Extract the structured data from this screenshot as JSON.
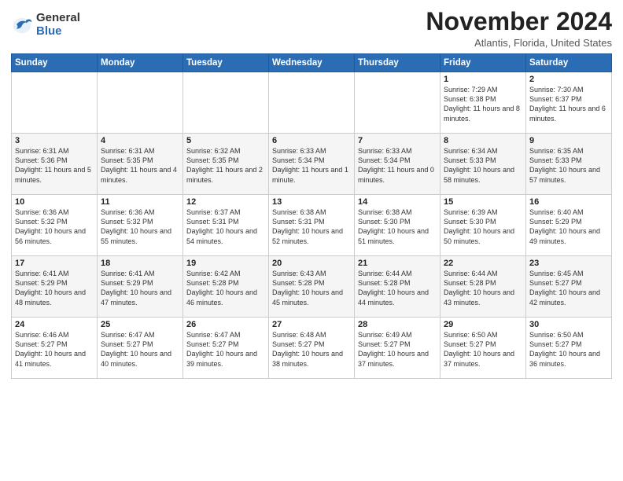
{
  "header": {
    "logo": {
      "general": "General",
      "blue": "Blue"
    },
    "title": "November 2024",
    "location": "Atlantis, Florida, United States"
  },
  "calendar": {
    "days_of_week": [
      "Sunday",
      "Monday",
      "Tuesday",
      "Wednesday",
      "Thursday",
      "Friday",
      "Saturday"
    ],
    "weeks": [
      [
        {
          "day": "",
          "info": ""
        },
        {
          "day": "",
          "info": ""
        },
        {
          "day": "",
          "info": ""
        },
        {
          "day": "",
          "info": ""
        },
        {
          "day": "",
          "info": ""
        },
        {
          "day": "1",
          "info": "Sunrise: 7:29 AM\nSunset: 6:38 PM\nDaylight: 11 hours\nand 8 minutes."
        },
        {
          "day": "2",
          "info": "Sunrise: 7:30 AM\nSunset: 6:37 PM\nDaylight: 11 hours\nand 6 minutes."
        }
      ],
      [
        {
          "day": "3",
          "info": "Sunrise: 6:31 AM\nSunset: 5:36 PM\nDaylight: 11 hours\nand 5 minutes."
        },
        {
          "day": "4",
          "info": "Sunrise: 6:31 AM\nSunset: 5:35 PM\nDaylight: 11 hours\nand 4 minutes."
        },
        {
          "day": "5",
          "info": "Sunrise: 6:32 AM\nSunset: 5:35 PM\nDaylight: 11 hours\nand 2 minutes."
        },
        {
          "day": "6",
          "info": "Sunrise: 6:33 AM\nSunset: 5:34 PM\nDaylight: 11 hours\nand 1 minute."
        },
        {
          "day": "7",
          "info": "Sunrise: 6:33 AM\nSunset: 5:34 PM\nDaylight: 11 hours\nand 0 minutes."
        },
        {
          "day": "8",
          "info": "Sunrise: 6:34 AM\nSunset: 5:33 PM\nDaylight: 10 hours\nand 58 minutes."
        },
        {
          "day": "9",
          "info": "Sunrise: 6:35 AM\nSunset: 5:33 PM\nDaylight: 10 hours\nand 57 minutes."
        }
      ],
      [
        {
          "day": "10",
          "info": "Sunrise: 6:36 AM\nSunset: 5:32 PM\nDaylight: 10 hours\nand 56 minutes."
        },
        {
          "day": "11",
          "info": "Sunrise: 6:36 AM\nSunset: 5:32 PM\nDaylight: 10 hours\nand 55 minutes."
        },
        {
          "day": "12",
          "info": "Sunrise: 6:37 AM\nSunset: 5:31 PM\nDaylight: 10 hours\nand 54 minutes."
        },
        {
          "day": "13",
          "info": "Sunrise: 6:38 AM\nSunset: 5:31 PM\nDaylight: 10 hours\nand 52 minutes."
        },
        {
          "day": "14",
          "info": "Sunrise: 6:38 AM\nSunset: 5:30 PM\nDaylight: 10 hours\nand 51 minutes."
        },
        {
          "day": "15",
          "info": "Sunrise: 6:39 AM\nSunset: 5:30 PM\nDaylight: 10 hours\nand 50 minutes."
        },
        {
          "day": "16",
          "info": "Sunrise: 6:40 AM\nSunset: 5:29 PM\nDaylight: 10 hours\nand 49 minutes."
        }
      ],
      [
        {
          "day": "17",
          "info": "Sunrise: 6:41 AM\nSunset: 5:29 PM\nDaylight: 10 hours\nand 48 minutes."
        },
        {
          "day": "18",
          "info": "Sunrise: 6:41 AM\nSunset: 5:29 PM\nDaylight: 10 hours\nand 47 minutes."
        },
        {
          "day": "19",
          "info": "Sunrise: 6:42 AM\nSunset: 5:28 PM\nDaylight: 10 hours\nand 46 minutes."
        },
        {
          "day": "20",
          "info": "Sunrise: 6:43 AM\nSunset: 5:28 PM\nDaylight: 10 hours\nand 45 minutes."
        },
        {
          "day": "21",
          "info": "Sunrise: 6:44 AM\nSunset: 5:28 PM\nDaylight: 10 hours\nand 44 minutes."
        },
        {
          "day": "22",
          "info": "Sunrise: 6:44 AM\nSunset: 5:28 PM\nDaylight: 10 hours\nand 43 minutes."
        },
        {
          "day": "23",
          "info": "Sunrise: 6:45 AM\nSunset: 5:27 PM\nDaylight: 10 hours\nand 42 minutes."
        }
      ],
      [
        {
          "day": "24",
          "info": "Sunrise: 6:46 AM\nSunset: 5:27 PM\nDaylight: 10 hours\nand 41 minutes."
        },
        {
          "day": "25",
          "info": "Sunrise: 6:47 AM\nSunset: 5:27 PM\nDaylight: 10 hours\nand 40 minutes."
        },
        {
          "day": "26",
          "info": "Sunrise: 6:47 AM\nSunset: 5:27 PM\nDaylight: 10 hours\nand 39 minutes."
        },
        {
          "day": "27",
          "info": "Sunrise: 6:48 AM\nSunset: 5:27 PM\nDaylight: 10 hours\nand 38 minutes."
        },
        {
          "day": "28",
          "info": "Sunrise: 6:49 AM\nSunset: 5:27 PM\nDaylight: 10 hours\nand 37 minutes."
        },
        {
          "day": "29",
          "info": "Sunrise: 6:50 AM\nSunset: 5:27 PM\nDaylight: 10 hours\nand 37 minutes."
        },
        {
          "day": "30",
          "info": "Sunrise: 6:50 AM\nSunset: 5:27 PM\nDaylight: 10 hours\nand 36 minutes."
        }
      ]
    ]
  }
}
